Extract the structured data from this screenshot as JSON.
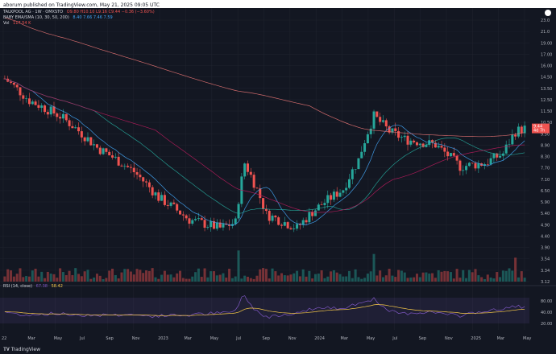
{
  "header": {
    "text": "aborum published on TradingView.com, May 21, 2025 09:05 UTC"
  },
  "legend": {
    "symbol": "TALKPOOL AG · 1W · OMXSTO",
    "ohlc": "O9.80 H10.10 L9.16 C9.44 −0.36 (−3.60%)",
    "ema_label": "BABY EMA/SMA (10, 30, 50, 200)",
    "ema_values": "8.40  7.66  7.46  7.59",
    "vol_label": "Vol",
    "vol_value": "117.54 K",
    "rsi_label": "RSI (14, close)",
    "rsi_value1": "67.38",
    "rsi_value2": "58.42"
  },
  "price_axis": [
    "23.0",
    "21.0",
    "19.00",
    "17.00",
    "16.00",
    "14.50",
    "13.50",
    "12.50",
    "11.50",
    "10.50",
    "9.50",
    "8.90",
    "8.30",
    "7.70",
    "7.10",
    "6.50",
    "5.90",
    "5.40",
    "4.90",
    "4.40",
    "3.90",
    "3.54",
    "3.34",
    "3.12"
  ],
  "current_price": {
    "value": "9.44",
    "sub": "4d 7h",
    "color": "#ef5350"
  },
  "rsi_axis": [
    "80.00",
    "40.00",
    "20.00"
  ],
  "time_axis": [
    "22",
    "Mar",
    "May",
    "Jul",
    "Sep",
    "Nov",
    "2023",
    "Mar",
    "May",
    "Jul",
    "Sep",
    "Nov",
    "2024",
    "Mar",
    "May",
    "Jul",
    "Sep",
    "Nov",
    "2025",
    "Mar",
    "May"
  ],
  "footer": {
    "logo": "TradingView"
  },
  "colors": {
    "up": "#26a69a",
    "down": "#ef5350",
    "bg": "#131722",
    "rsi": "#7e57c2",
    "rsi_ma": "#f7c948"
  }
}
